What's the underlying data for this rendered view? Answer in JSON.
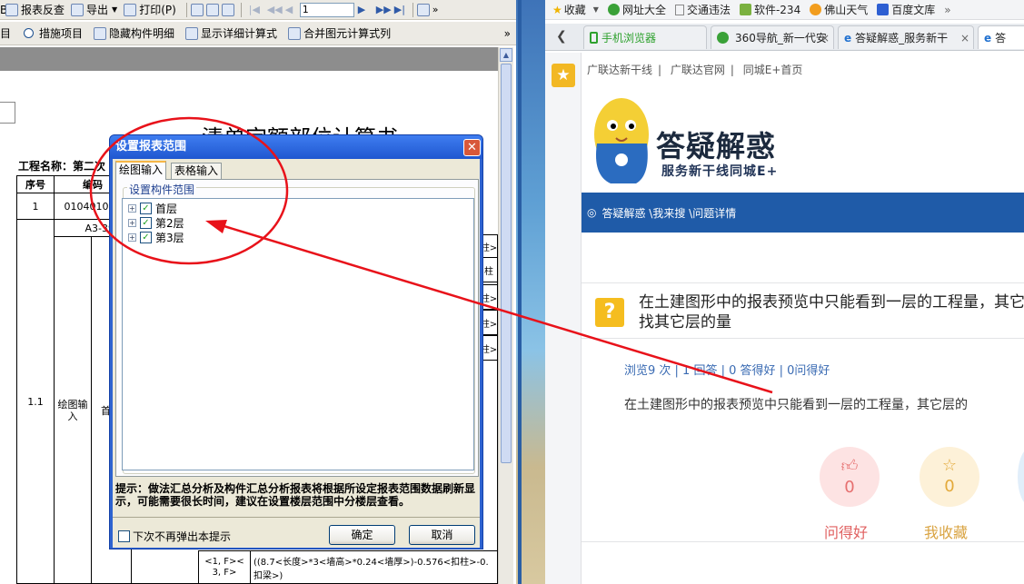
{
  "left_app": {
    "toolbar1": {
      "items": [
        "报表反查",
        "导出",
        "打印(P)"
      ],
      "page_value": "1"
    },
    "toolbar2": {
      "items": [
        "措施项目",
        "隐藏构件明细",
        "显示详细计算式",
        "合并图元计算式列"
      ]
    },
    "doc": {
      "title": "清单定额部位计算书",
      "project_label": "工程名称：第二次",
      "headers": [
        "序号",
        "编码"
      ],
      "row1_num": "1",
      "row1_code": "010401003",
      "row1_sub": "A3-39",
      "row2_num": "1.1",
      "row2_a": "绘图输入",
      "row2_b": "首",
      "side_labels": [
        "柱>",
        "柱",
        "柱>",
        "柱>",
        "柱>"
      ],
      "bottom_left": "<1, F>< 3, F>",
      "bottom_right": "((8.7<长度>*3<墙高>*0.24<墙厚>)-0.576<扣柱>-0.",
      "bottom_right2": "扣梁>)"
    }
  },
  "dialog": {
    "title": "设置报表范围",
    "close_glyph": "✕",
    "tabs": [
      "绘图输入",
      "表格输入"
    ],
    "group_label": "设置构件范围",
    "tree": [
      {
        "label": "首层",
        "checked": true
      },
      {
        "label": "第2层",
        "checked": true
      },
      {
        "label": "第3层",
        "checked": true
      }
    ],
    "hint": "提示：做法汇总分析及构件汇总分析报表将根据所设定报表范围数据刷新显示，可能需要很长时间，建议在设置楼层范围中分楼层查看。",
    "no_show_label": "下次不再弹出本提示",
    "ok_label": "确定",
    "cancel_label": "取消"
  },
  "browser": {
    "favorites": [
      "收藏",
      "网址大全",
      "交通违法",
      "软件-234",
      "佛山天气",
      "百度文库"
    ],
    "tabs": [
      "手机浏览器",
      "360导航_新一代安",
      "答疑解惑_服务新干",
      "答"
    ],
    "top_links": [
      "广联达新干线",
      "广联达官网",
      "同城E+首页"
    ],
    "brand_title": "答疑解惑",
    "brand_sub": "服务新干线同城E+",
    "breadcrumb": "答疑解惑 \\我来搜 \\问题详情",
    "question_title": "在土建图形中的报表预览中只能看到一层的工程量，其它层的量哪找其它层的量",
    "stats": "浏览9 次 | 1 回答 | 0 答得好 | 0问得好",
    "question_body": "在土建图形中的报表预览中只能看到一层的工程量，其它层的",
    "good_count": "0",
    "good_label": "问得好",
    "fav_count": "0",
    "fav_label": "我收藏"
  },
  "colors": {
    "accent_blue": "#1f5ba8",
    "annotation_red": "#e8121a",
    "question_icon": "#f5bd1f"
  }
}
